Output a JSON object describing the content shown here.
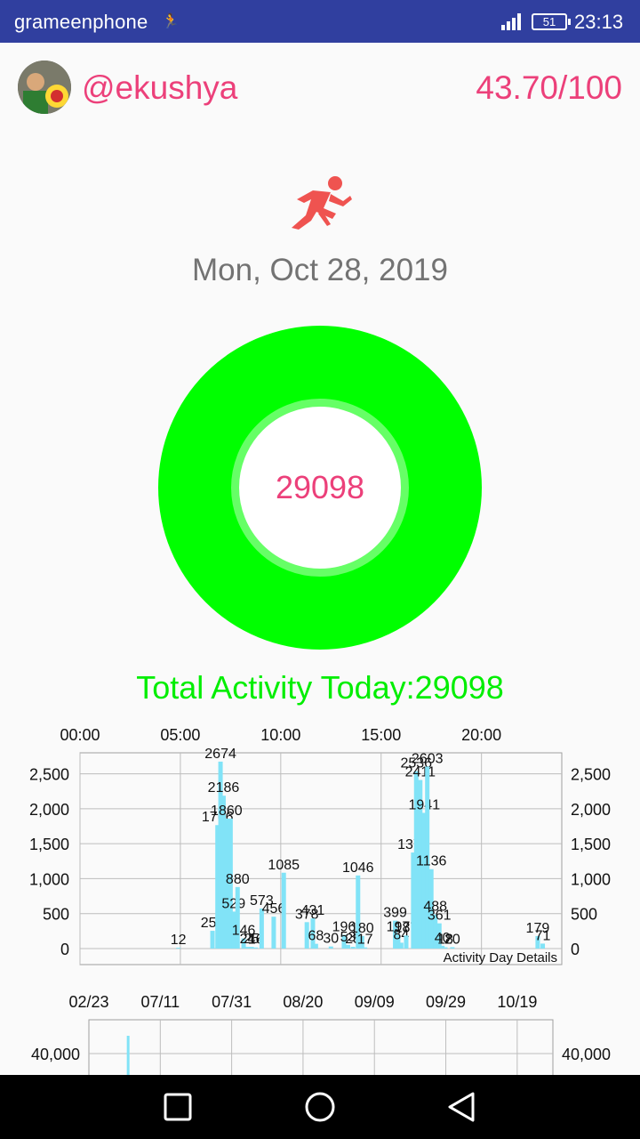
{
  "status_bar": {
    "carrier": "grameenphone",
    "battery": "51",
    "time": "23:13"
  },
  "header": {
    "username": "@ekushya",
    "score": "43.70/100"
  },
  "activity_date": "Mon, Oct 28, 2019",
  "ring": {
    "value": "29098",
    "outer_color": "#00ff00",
    "inner_color": "#66ff66"
  },
  "total_activity": "Total Activity Today:29098",
  "colors": {
    "accent": "#ec407a",
    "status_bar": "#303f9f",
    "bars": "#81e3f7",
    "grid": "#bdbdbd"
  },
  "chart_data": [
    {
      "type": "bar",
      "description": "Activity Day Details",
      "caption": "Activity Day Details",
      "x_tick_labels": [
        "00:00",
        "05:00",
        "10:00",
        "15:00",
        "20:00"
      ],
      "y_tick_labels": [
        "0",
        "500",
        "1,000",
        "1,500",
        "2,000",
        "2,500"
      ],
      "ylim": [
        0,
        2800
      ],
      "xlim_hours": [
        0,
        24
      ],
      "grid": true,
      "bar_color": "#81e3f7",
      "points": [
        {
          "t": 4.9,
          "v": 12,
          "label": "12"
        },
        {
          "t": 6.6,
          "v": 254,
          "label": "254"
        },
        {
          "t": 6.85,
          "v": 1766,
          "label": "1766"
        },
        {
          "t": 7.0,
          "v": 2674,
          "label": "2674"
        },
        {
          "t": 7.15,
          "v": 2186,
          "label": "2186"
        },
        {
          "t": 7.3,
          "v": 1860,
          "label": "1860"
        },
        {
          "t": 7.5,
          "v": 1860,
          "label": ""
        },
        {
          "t": 7.65,
          "v": 529,
          "label": "529"
        },
        {
          "t": 7.85,
          "v": 880,
          "label": "880"
        },
        {
          "t": 8.15,
          "v": 146,
          "label": "146"
        },
        {
          "t": 8.35,
          "v": 24,
          "label": "24"
        },
        {
          "t": 8.55,
          "v": 25,
          "label": "25"
        },
        {
          "t": 8.75,
          "v": 16,
          "label": "16"
        },
        {
          "t": 9.05,
          "v": 573,
          "label": "573"
        },
        {
          "t": 9.65,
          "v": 456,
          "label": "456"
        },
        {
          "t": 10.15,
          "v": 1085,
          "label": "1085"
        },
        {
          "t": 11.3,
          "v": 378,
          "label": "378"
        },
        {
          "t": 11.6,
          "v": 431,
          "label": "431"
        },
        {
          "t": 11.75,
          "v": 68,
          "label": "68"
        },
        {
          "t": 12.5,
          "v": 30,
          "label": "30"
        },
        {
          "t": 13.15,
          "v": 196,
          "label": "196"
        },
        {
          "t": 13.35,
          "v": 53,
          "label": "53"
        },
        {
          "t": 13.6,
          "v": 25,
          "label": "25"
        },
        {
          "t": 13.85,
          "v": 1046,
          "label": "1046"
        },
        {
          "t": 14.05,
          "v": 180,
          "label": "180"
        },
        {
          "t": 14.2,
          "v": 17,
          "label": "17"
        },
        {
          "t": 15.7,
          "v": 399,
          "label": "399"
        },
        {
          "t": 15.85,
          "v": 197,
          "label": "197"
        },
        {
          "t": 16.0,
          "v": 84,
          "label": "84"
        },
        {
          "t": 16.25,
          "v": 187,
          "label": "187"
        },
        {
          "t": 16.6,
          "v": 1374,
          "label": "1374"
        },
        {
          "t": 16.75,
          "v": 2536,
          "label": "2536"
        },
        {
          "t": 16.95,
          "v": 2411,
          "label": "2411"
        },
        {
          "t": 17.15,
          "v": 1941,
          "label": "1941"
        },
        {
          "t": 17.3,
          "v": 2603,
          "label": "2603"
        },
        {
          "t": 17.5,
          "v": 1136,
          "label": "1136"
        },
        {
          "t": 17.7,
          "v": 488,
          "label": "488"
        },
        {
          "t": 17.9,
          "v": 361,
          "label": "361"
        },
        {
          "t": 18.05,
          "v": 40,
          "label": "40"
        },
        {
          "t": 18.2,
          "v": 18,
          "label": "18"
        },
        {
          "t": 18.55,
          "v": 20,
          "label": "20"
        },
        {
          "t": 22.8,
          "v": 179,
          "label": "179"
        },
        {
          "t": 23.05,
          "v": 71,
          "label": "71"
        }
      ]
    },
    {
      "type": "bar",
      "x_tick_labels": [
        "02/23",
        "07/11",
        "07/31",
        "08/20",
        "09/09",
        "09/29",
        "10/19"
      ],
      "y_tick_labels": [
        "40,000"
      ],
      "ylim": [
        0,
        50000
      ],
      "grid": true,
      "bar_color": "#81e3f7",
      "points": [
        {
          "slot": 0.55,
          "v": 45000
        }
      ]
    }
  ]
}
